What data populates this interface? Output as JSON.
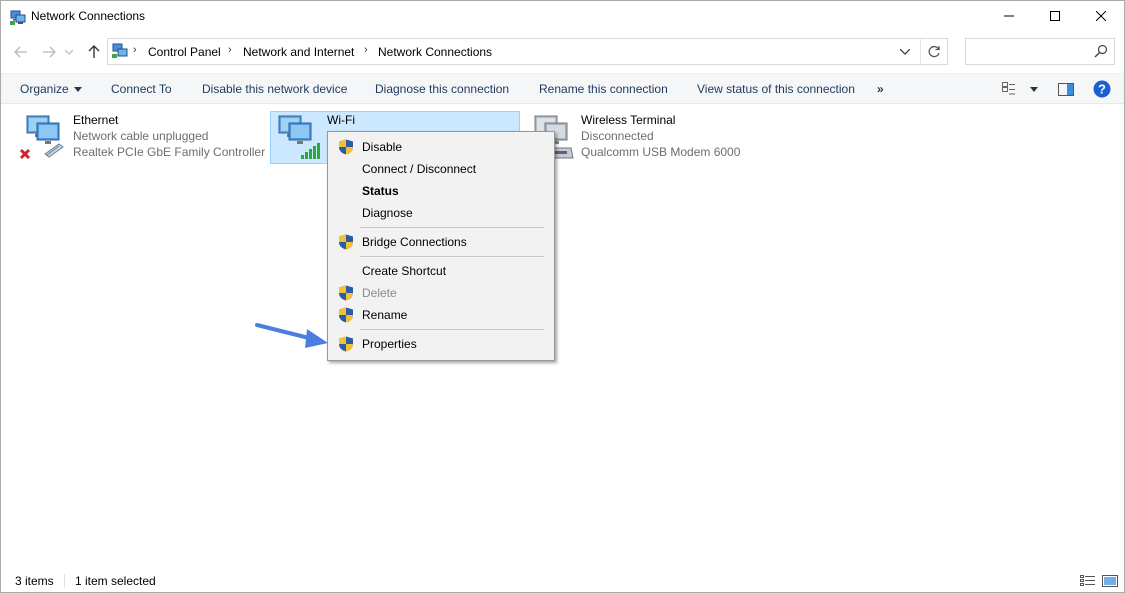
{
  "window": {
    "title": "Network Connections",
    "icon": "network-connections-icon"
  },
  "address": {
    "breadcrumbs": [
      "Control Panel",
      "Network and Internet",
      "Network Connections"
    ],
    "search_placeholder": ""
  },
  "toolbar": {
    "organize": "Organize",
    "connect_to": "Connect To",
    "disable": "Disable this network device",
    "diagnose": "Diagnose this connection",
    "rename": "Rename this connection",
    "view_status": "View status of this connection",
    "more": "»"
  },
  "connections": [
    {
      "name": "Ethernet",
      "status": "Network cable unplugged",
      "device": "Realtek PCIe GbE Family Controller",
      "icon": "ethernet-icon",
      "selected": false
    },
    {
      "name": "Wi-Fi",
      "status": "",
      "device": "",
      "icon": "wifi-icon",
      "selected": true
    },
    {
      "name": "Wireless Terminal",
      "status": "Disconnected",
      "device": "Qualcomm USB Modem 6000",
      "icon": "modem-icon",
      "selected": false
    }
  ],
  "context_menu": {
    "items": [
      {
        "label": "Disable",
        "shield": true,
        "bold": false,
        "disabled": false
      },
      {
        "label": "Connect / Disconnect",
        "shield": false,
        "bold": false,
        "disabled": false
      },
      {
        "label": "Status",
        "shield": false,
        "bold": true,
        "disabled": false
      },
      {
        "label": "Diagnose",
        "shield": false,
        "bold": false,
        "disabled": false
      },
      {
        "label": "Bridge Connections",
        "shield": true,
        "bold": false,
        "disabled": false
      },
      {
        "label": "Create Shortcut",
        "shield": false,
        "bold": false,
        "disabled": false
      },
      {
        "label": "Delete",
        "shield": true,
        "bold": false,
        "disabled": true
      },
      {
        "label": "Rename",
        "shield": true,
        "bold": false,
        "disabled": false
      },
      {
        "label": "Properties",
        "shield": true,
        "bold": false,
        "disabled": false
      }
    ]
  },
  "status_bar": {
    "item_count": "3 items",
    "selection": "1 item selected"
  },
  "colors": {
    "selection_bg": "#cce8ff",
    "arrow": "#4a7fe0",
    "help": "#1a5fd0"
  }
}
